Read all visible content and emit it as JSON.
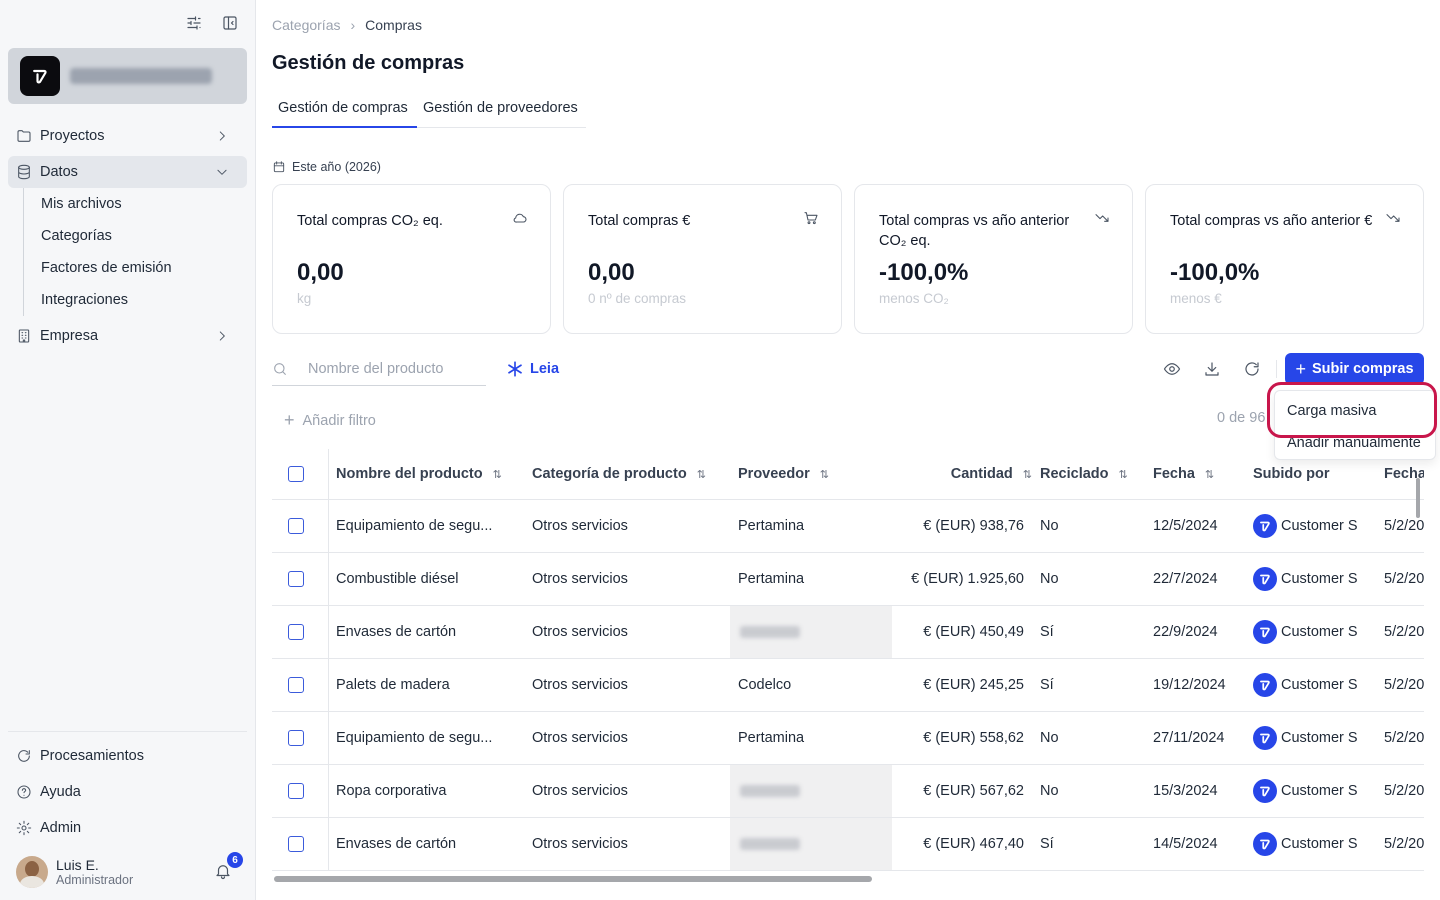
{
  "sidebar": {
    "nav": [
      {
        "label": "Proyectos"
      },
      {
        "label": "Datos"
      },
      {
        "label": "Empresa"
      }
    ],
    "datos_sub": [
      "Mis archivos",
      "Categorías",
      "Factores de emisión",
      "Integraciones"
    ],
    "bottom": [
      {
        "label": "Procesamientos"
      },
      {
        "label": "Ayuda"
      },
      {
        "label": "Admin"
      }
    ],
    "user": {
      "name": "Luis E.",
      "role": "Administrador",
      "notifications": "6"
    }
  },
  "breadcrumb": {
    "parent": "Categorías",
    "current": "Compras"
  },
  "page_title": "Gestión de compras",
  "tabs": [
    "Gestión de compras",
    "Gestión de proveedores"
  ],
  "period": "Este año (2026)",
  "cards": [
    {
      "title": "Total compras CO₂ eq.",
      "value": "0,00",
      "sub": "kg",
      "icon": "cloud-icon"
    },
    {
      "title": "Total compras €",
      "value": "0,00",
      "sub": "0 nº de compras",
      "icon": "cart-icon"
    },
    {
      "title": "Total compras vs año anterior CO₂ eq.",
      "value": "-100,0%",
      "sub": "menos CO₂",
      "icon": "trend-down-icon"
    },
    {
      "title": "Total compras vs año anterior €",
      "value": "-100,0%",
      "sub": "menos €",
      "icon": "trend-down-icon"
    }
  ],
  "search": {
    "placeholder": "Nombre del producto"
  },
  "leia_label": "Leia",
  "upload_label": "Subir compras",
  "add_filter": "Añadir filtro",
  "count_text": "0 de 96",
  "dropdown": [
    "Carga masiva",
    "Añadir manualmente"
  ],
  "table": {
    "headers": [
      "Nombre del producto",
      "Categoría de producto",
      "Proveedor",
      "Cantidad",
      "Reciclado",
      "Fecha",
      "Subido por",
      "Fecha"
    ],
    "rows": [
      {
        "name": "Equipamiento de segu...",
        "cat": "Otros servicios",
        "prov": "Pertamina",
        "qty": "€ (EUR) 938,76",
        "rec": "No",
        "date": "12/5/2024",
        "by": "Customer S",
        "date2": "5/2/20"
      },
      {
        "name": "Combustible diésel",
        "cat": "Otros servicios",
        "prov": "Pertamina",
        "qty": "€ (EUR) 1.925,60",
        "rec": "No",
        "date": "22/7/2024",
        "by": "Customer S",
        "date2": "5/2/20"
      },
      {
        "name": "Envases de cartón",
        "cat": "Otros servicios",
        "prov": "",
        "qty": "€ (EUR) 450,49",
        "rec": "Sí",
        "date": "22/9/2024",
        "by": "Customer S",
        "date2": "5/2/20"
      },
      {
        "name": "Palets de madera",
        "cat": "Otros servicios",
        "prov": "Codelco",
        "qty": "€ (EUR) 245,25",
        "rec": "Sí",
        "date": "19/12/2024",
        "by": "Customer S",
        "date2": "5/2/20"
      },
      {
        "name": "Equipamiento de segu...",
        "cat": "Otros servicios",
        "prov": "Pertamina",
        "qty": "€ (EUR) 558,62",
        "rec": "No",
        "date": "27/11/2024",
        "by": "Customer S",
        "date2": "5/2/20"
      },
      {
        "name": "Ropa corporativa",
        "cat": "Otros servicios",
        "prov": "",
        "qty": "€ (EUR) 567,62",
        "rec": "No",
        "date": "15/3/2024",
        "by": "Customer S",
        "date2": "5/2/20"
      },
      {
        "name": "Envases de cartón",
        "cat": "Otros servicios",
        "prov": "",
        "qty": "€ (EUR) 467,40",
        "rec": "Sí",
        "date": "14/5/2024",
        "by": "Customer S",
        "date2": "5/2/20"
      }
    ]
  }
}
